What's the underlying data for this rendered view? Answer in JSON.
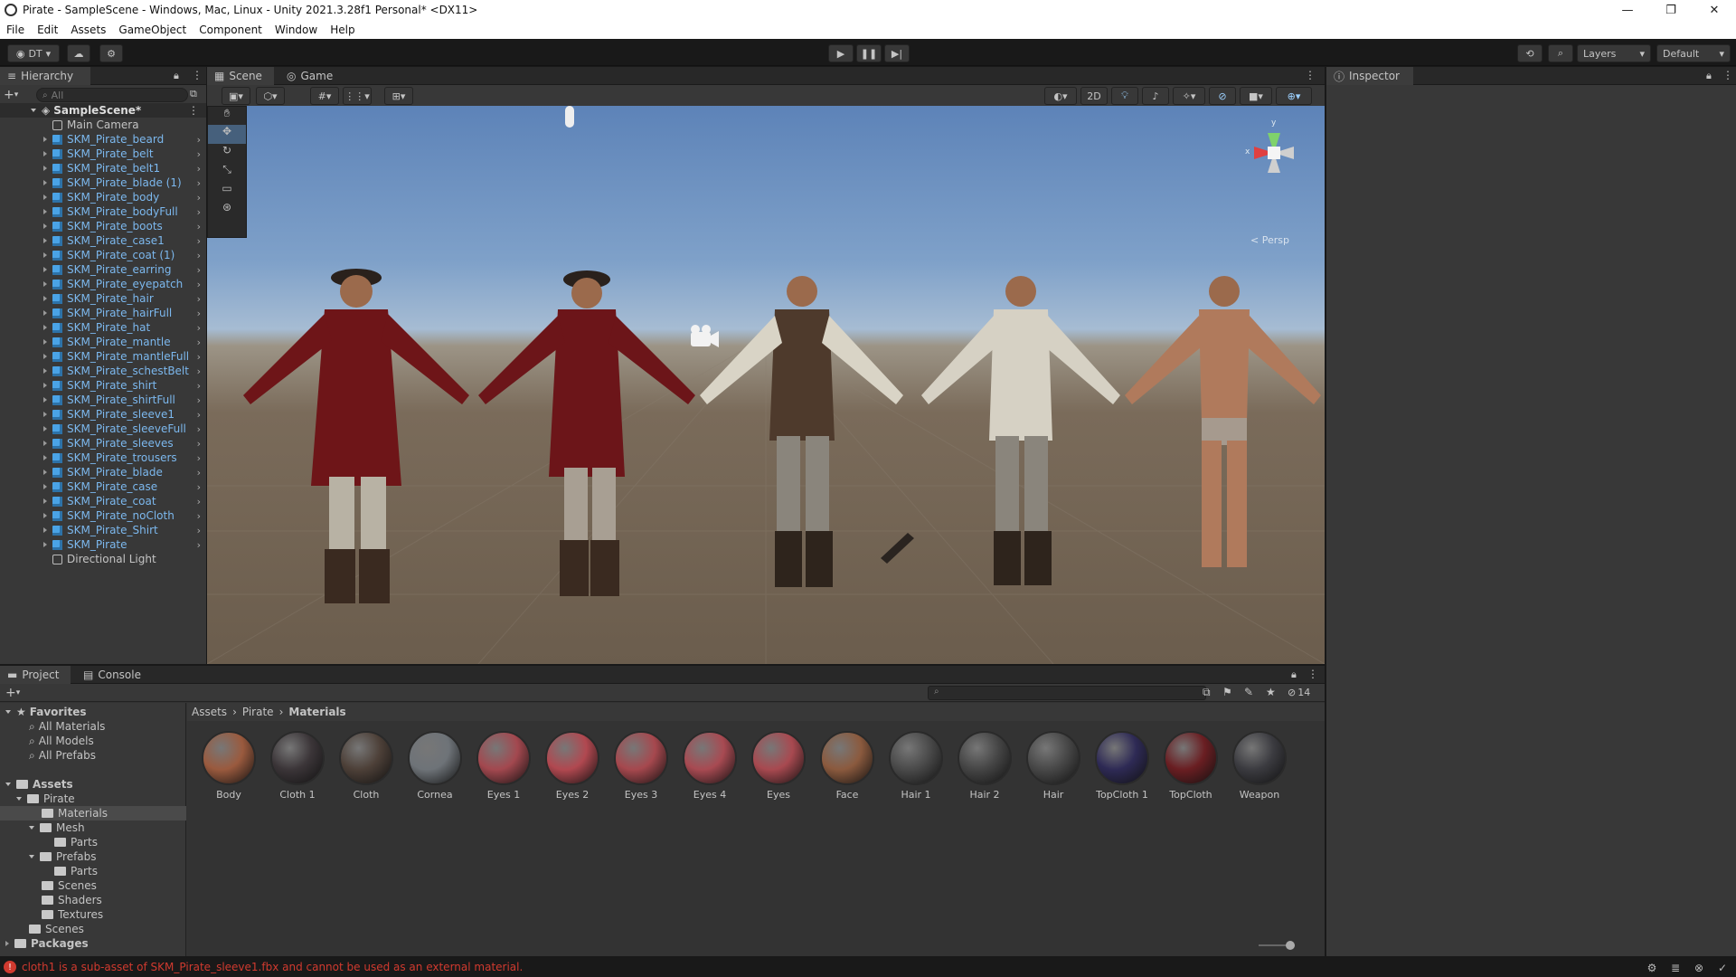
{
  "window": {
    "title": "Pirate - SampleScene - Windows, Mac, Linux - Unity 2021.3.28f1 Personal* <DX11>",
    "minimize": "—",
    "maximize": "❐",
    "close": "✕"
  },
  "menu": [
    "File",
    "Edit",
    "Assets",
    "GameObject",
    "Component",
    "Window",
    "Help"
  ],
  "toolbar": {
    "account_label": "DT",
    "layers_label": "Layers",
    "layout_label": "Default"
  },
  "hierarchy": {
    "tab": "Hierarchy",
    "search_placeholder": "All",
    "scene_name": "SampleScene*",
    "items": [
      "Main Camera",
      "SKM_Pirate_beard",
      "SKM_Pirate_belt",
      "SKM_Pirate_belt1",
      "SKM_Pirate_blade (1)",
      "SKM_Pirate_body",
      "SKM_Pirate_bodyFull",
      "SKM_Pirate_boots",
      "SKM_Pirate_case1",
      "SKM_Pirate_coat (1)",
      "SKM_Pirate_earring",
      "SKM_Pirate_eyepatch",
      "SKM_Pirate_hair",
      "SKM_Pirate_hairFull",
      "SKM_Pirate_hat",
      "SKM_Pirate_mantle",
      "SKM_Pirate_mantleFull",
      "SKM_Pirate_schestBelt",
      "SKM_Pirate_shirt",
      "SKM_Pirate_shirtFull",
      "SKM_Pirate_sleeve1",
      "SKM_Pirate_sleeveFull",
      "SKM_Pirate_sleeves",
      "SKM_Pirate_trousers",
      "SKM_Pirate_blade",
      "SKM_Pirate_case",
      "SKM_Pirate_coat",
      "SKM_Pirate_noCloth",
      "SKM_Pirate_Shirt",
      "SKM_Pirate",
      "Directional Light"
    ]
  },
  "scene": {
    "tab_scene": "Scene",
    "tab_game": "Game",
    "btn_2d": "2D",
    "persp_label": "< Persp",
    "gizmo_y": "y",
    "gizmo_x": "x"
  },
  "inspector": {
    "tab": "Inspector"
  },
  "project": {
    "tab_project": "Project",
    "tab_console": "Console",
    "hidden_count": "14",
    "favorites_label": "Favorites",
    "favorites": [
      "All Materials",
      "All Models",
      "All Prefabs"
    ],
    "assets_label": "Assets",
    "packages_label": "Packages",
    "tree": {
      "pirate": "Pirate",
      "materials": "Materials",
      "mesh": "Mesh",
      "mesh_parts": "Parts",
      "prefabs": "Prefabs",
      "prefabs_parts": "Parts",
      "scenes": "Scenes",
      "shaders": "Shaders",
      "textures": "Textures",
      "root_scenes": "Scenes"
    },
    "breadcrumb": [
      "Assets",
      "Pirate",
      "Materials"
    ],
    "materials": [
      {
        "name": "Body",
        "color": "#9a5a3e"
      },
      {
        "name": "Cloth 1",
        "color": "#3b3538"
      },
      {
        "name": "Cloth",
        "color": "#4d4038"
      },
      {
        "name": "Cornea",
        "color": "#6e7378"
      },
      {
        "name": "Eyes 1",
        "color": "#a3484f"
      },
      {
        "name": "Eyes 2",
        "color": "#b14850"
      },
      {
        "name": "Eyes 3",
        "color": "#a6484e"
      },
      {
        "name": "Eyes 4",
        "color": "#a84a52"
      },
      {
        "name": "Eyes",
        "color": "#a84950"
      },
      {
        "name": "Face",
        "color": "#8b5a3e"
      },
      {
        "name": "Hair 1",
        "color": "#4a4a4a"
      },
      {
        "name": "Hair 2",
        "color": "#454545"
      },
      {
        "name": "Hair",
        "color": "#484848"
      },
      {
        "name": "TopCloth 1",
        "color": "#2e2a55"
      },
      {
        "name": "TopCloth",
        "color": "#6a1e22"
      },
      {
        "name": "Weapon",
        "color": "#3b3b40"
      }
    ]
  },
  "status": {
    "message": "cloth1 is a sub-asset of SKM_Pirate_sleeve1.fbx and cannot be used as an external material."
  },
  "colors": {
    "editor_bg": "#383838",
    "toolbar_bg": "#191919",
    "accent_blue": "#4aa3e6",
    "error_red": "#d03a2f"
  }
}
